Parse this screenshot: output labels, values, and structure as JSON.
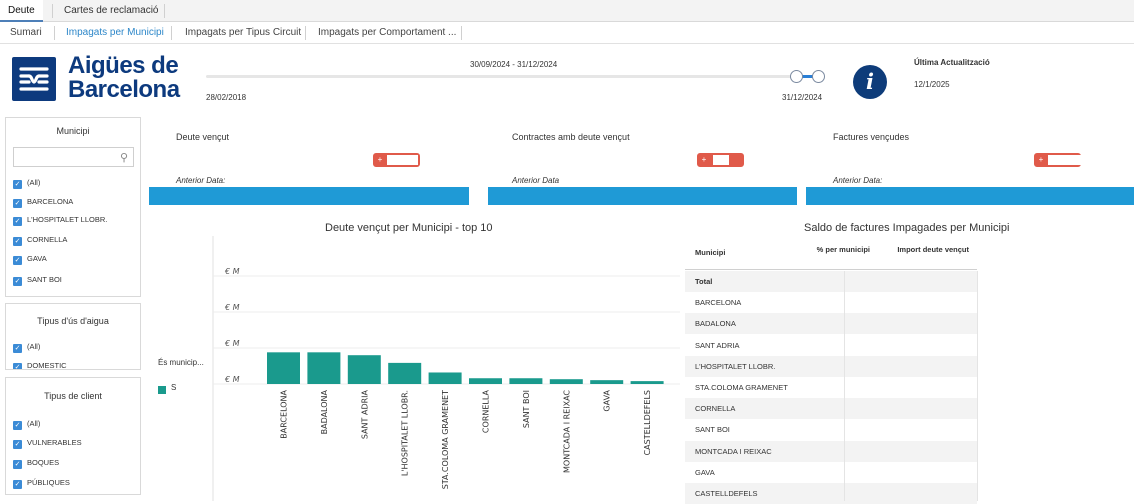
{
  "tabs": {
    "row1": [
      "Deute",
      "Cartes de reclamació"
    ],
    "row2": [
      "Sumari",
      "Impagats per Municipi",
      "Impagats per Tipus Circuit",
      "Impagats per Comportament ..."
    ]
  },
  "header": {
    "logo_line1": "Aigües de",
    "logo_line2": "Barcelona",
    "range_label": "30/09/2024 - 31/12/2024",
    "start_date": "28/02/2018",
    "end_date": "31/12/2024",
    "update_label": "Última Actualització",
    "update_value": "12/1/2025",
    "info_glyph": "i",
    "info_icon": "info-icon"
  },
  "filters": {
    "municipi": {
      "title": "Municipi",
      "items": [
        "(All)",
        "BARCELONA",
        "L'HOSPITALET LLOBR.",
        "CORNELLA",
        "GAVA",
        "SANT BOI"
      ]
    },
    "tipus_us": {
      "title": "Tipus d'ús d'aigua",
      "items": [
        "(All)",
        "DOMESTIC"
      ]
    },
    "tipus_client": {
      "title": "Tipus de client",
      "items": [
        "(All)",
        "VULNERABLES",
        "BOQUES",
        "PÚBLIQUES"
      ]
    }
  },
  "kpis": [
    {
      "label": "Deute vençut",
      "prev": "Anterior Data:"
    },
    {
      "label": "Contractes amb deute vençut",
      "prev": "Anterior Data"
    },
    {
      "label": "Factures vençudes",
      "prev": "Anterior Data:"
    }
  ],
  "kpi_button_glyph": "+",
  "chart_data": {
    "type": "bar",
    "title": "Deute vençut per Municipi - top 10",
    "legend_title": "És municip...",
    "series": [
      {
        "name": "S",
        "values": [
          33,
          33,
          30,
          22,
          12,
          6,
          6,
          5,
          4,
          3
        ]
      }
    ],
    "categories": [
      "BARCELONA",
      "BADALONA",
      "SANT ADRIA",
      "L'HOSPITALET LLOBR.",
      "STA.COLOMA GRAMENET",
      "CORNELLA",
      "SANT BOI",
      "MONTCADA I REIXAC",
      "GAVA",
      "CASTELLDEFELS"
    ],
    "ylim": [
      0,
      150
    ],
    "y_tick_text": "€ M",
    "grid": true,
    "color": "#1a9a8d"
  },
  "table": {
    "title": "Saldo de factures Impagades per Municipi",
    "headers": [
      "Municipi",
      "% per municipi",
      "Import deute vençut"
    ],
    "rows": [
      "Total",
      "BARCELONA",
      "BADALONA",
      "SANT ADRIA",
      "L'HOSPITALET LLOBR.",
      "STA.COLOMA GRAMENET",
      "CORNELLA",
      "SANT BOI",
      "MONTCADA I REIXAC",
      "GAVA",
      "CASTELLDEFELS"
    ]
  },
  "colors": {
    "accent": "#2d87c9",
    "brand": "#0d3a7e",
    "kpi_bar": "#1f9ad6",
    "kpi_button": "#e05a4a",
    "bar": "#1a9a8d"
  }
}
